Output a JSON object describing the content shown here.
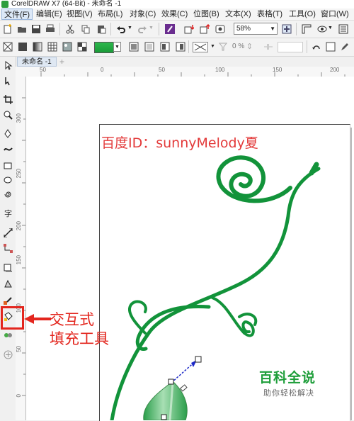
{
  "window": {
    "title": "CorelDRAW X7 (64-Bit) - 未命名 -1"
  },
  "menu": [
    {
      "label": "文件(F)"
    },
    {
      "label": "编辑(E)"
    },
    {
      "label": "视图(V)"
    },
    {
      "label": "布局(L)"
    },
    {
      "label": "对象(C)"
    },
    {
      "label": "效果(C)"
    },
    {
      "label": "位图(B)"
    },
    {
      "label": "文本(X)"
    },
    {
      "label": "表格(T)"
    },
    {
      "label": "工具(O)"
    },
    {
      "label": "窗口(W)"
    }
  ],
  "toolbar": {
    "zoom_value": "58%",
    "transparency_value": "0 %"
  },
  "document": {
    "tab_label": "未命名 -1",
    "add_tab": "+"
  },
  "ruler": {
    "h_labels": [
      "50",
      "0",
      "50",
      "100",
      "150",
      "200"
    ],
    "v_labels": [
      "300",
      "250",
      "200",
      "150",
      "100",
      "50",
      "0"
    ]
  },
  "watermark": {
    "text": "百度ID：sunnyMelody夏"
  },
  "callout": {
    "line1": "交互式",
    "line2": "填充工具",
    "color": "#e3261e"
  },
  "branding": {
    "title": "百科全说",
    "subtitle": "助你轻松解决",
    "color": "#1e9e3a"
  },
  "colors": {
    "vine": "#12933a",
    "leaf_light": "#a8dfb4",
    "leaf_dark": "#2a9e4a",
    "vector_line": "#1c28c8"
  }
}
